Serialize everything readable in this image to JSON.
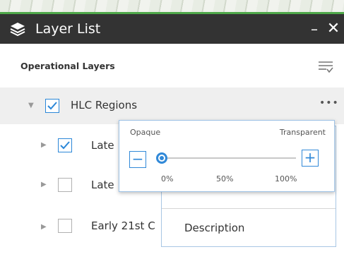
{
  "window": {
    "title": "Layer List",
    "minimize_label": "–",
    "close_label": "✕",
    "title_icon": "layers-icon"
  },
  "panel": {
    "section_title": "Operational Layers",
    "filter_icon": "filter-list-icon"
  },
  "layers": [
    {
      "label": "HLC Regions",
      "checked": true,
      "expanded": true,
      "selected": true
    },
    {
      "label": "Late",
      "checked": true,
      "expanded": false
    },
    {
      "label": "Late",
      "checked": false,
      "expanded": false
    },
    {
      "label": "Early 21st C",
      "checked": false,
      "expanded": false
    }
  ],
  "layer_menu": {
    "more_label": "•••",
    "description_label": "Description"
  },
  "transparency": {
    "left_label": "Opaque",
    "right_label": "Transparent",
    "decrease_label": "−",
    "increase_label": "+",
    "ticks": [
      "0%",
      "50%",
      "100%"
    ],
    "value_percent": 0
  },
  "colors": {
    "accent": "#3189d8",
    "titlebar": "#333333",
    "map_edge": "#4fa84a"
  }
}
